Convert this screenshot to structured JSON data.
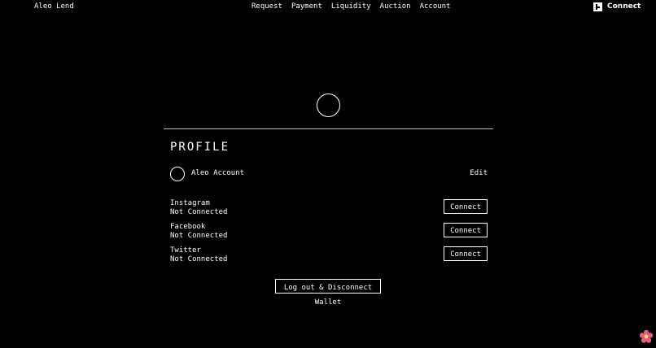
{
  "header": {
    "brand": "Aleo Lend",
    "nav": [
      "Request",
      "Payment",
      "Liquidity",
      "Auction",
      "Account"
    ],
    "connect_label": "Connect"
  },
  "profile": {
    "title": "PROFILE",
    "account_label": "Aleo Account",
    "edit_label": "Edit",
    "socials": [
      {
        "name": "Instagram",
        "status": "Not Connected",
        "button": "Connect"
      },
      {
        "name": "Facebook",
        "status": "Not Connected",
        "button": "Connect"
      },
      {
        "name": "Twitter",
        "status": "Not Connected",
        "button": "Connect"
      }
    ],
    "logout_label": "Log out & Disconnect Wallet"
  },
  "icons": {
    "wallet": "wallet-icon",
    "flower": "flower-icon"
  },
  "colors": {
    "background": "#000000",
    "text": "#ffffff",
    "divider": "#bdbdbd",
    "flower": "#e0607e"
  }
}
